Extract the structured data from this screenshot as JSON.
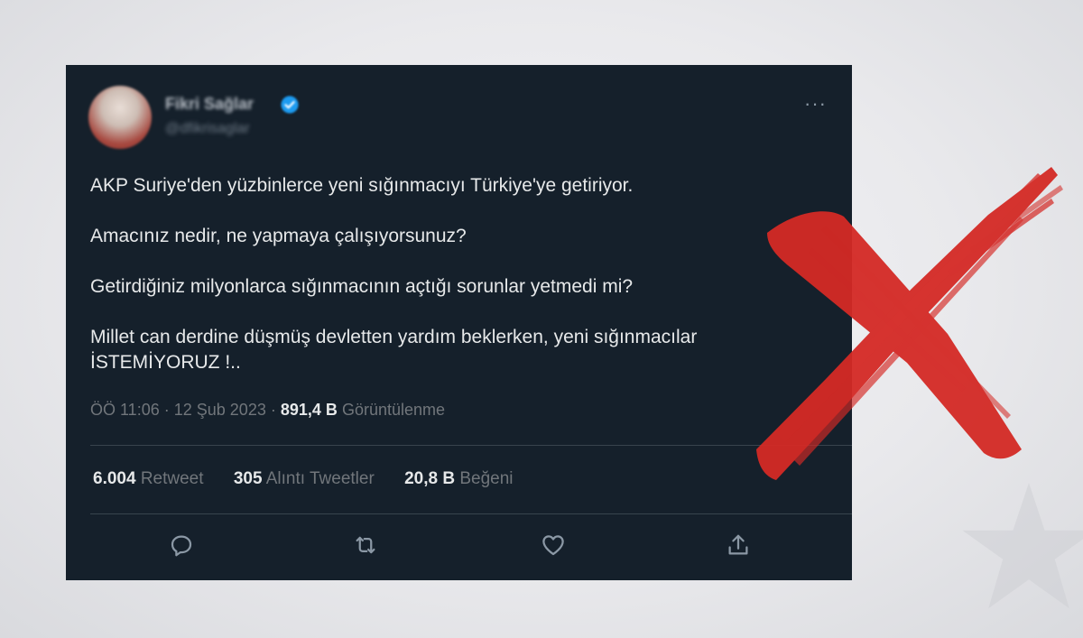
{
  "tweet": {
    "author_name": "Fikri Sağlar",
    "author_handle": "@dfikrisaglar",
    "more_label": "···",
    "paragraphs": [
      "AKP Suriye'den yüzbinlerce yeni sığınmacıyı Türkiye'ye getiriyor.",
      "Amacınız nedir, ne yapmaya çalışıyorsunuz?",
      "Getirdiğiniz milyonlarca sığınmacının açtığı sorunlar yetmedi mi?",
      "Millet can derdine düşmüş devletten yardım beklerken, yeni sığınmacılar İSTEMİYORUZ !.."
    ],
    "time": "ÖÖ 11:06",
    "date": "12 Şub 2023",
    "separator": "·",
    "views_count": "891,4 B",
    "views_label": "Görüntülenme",
    "stats": {
      "retweets_count": "6.004",
      "retweets_label": "Retweet",
      "quotes_count": "305",
      "quotes_label": "Alıntı Tweetler",
      "likes_count": "20,8 B",
      "likes_label": "Beğeni"
    },
    "actions": [
      "reply-icon",
      "retweet-icon",
      "like-icon",
      "share-icon"
    ]
  },
  "colors": {
    "card_background": "#15202b",
    "text_primary": "#e7e9ea",
    "text_secondary": "#71767b",
    "divider": "#38444d",
    "verified_blue": "#1d9bf0",
    "cross_red": "#d42a25"
  },
  "overlay": {
    "icon": "red-cross-icon"
  }
}
